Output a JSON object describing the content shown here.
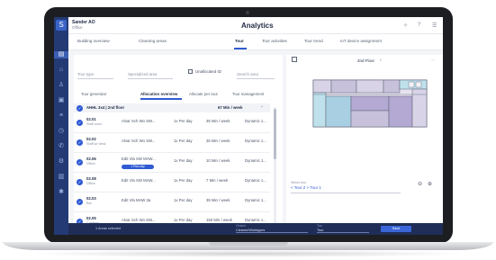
{
  "header": {
    "org_name": "Sander AO",
    "org_sub": "Office",
    "title": "Analytics"
  },
  "tabs": [
    {
      "label": "Building overview"
    },
    {
      "label": "Cleaning areas"
    },
    {
      "label": "Tour"
    },
    {
      "label": "Tour activities"
    },
    {
      "label": "Tour trend"
    },
    {
      "label": "IoT device assignment"
    }
  ],
  "filters": {
    "tour_type": "Tour type",
    "area": "Specialized area",
    "unallocated": "Unallocated ID",
    "search": "Search area"
  },
  "subtabs": [
    {
      "label": "Tour generator"
    },
    {
      "label": "Allocation overview"
    },
    {
      "label": "Allocate per tour"
    },
    {
      "label": "Tour management"
    }
  ],
  "table": {
    "header_col1": "AHHL 3x4 | 2nd floor",
    "header_col2": "67 Min / week",
    "rows": [
      {
        "code": "02.01",
        "sub": "Staff room",
        "area": "Alvar Sch Wo SW...",
        "freq": "1x Per day",
        "time": "35 Min / week",
        "status": "Dynamic 1...",
        "badge": ""
      },
      {
        "code": "02.02",
        "sub": "Staff w/ desk",
        "area": "Alvar Sch Wo SW...",
        "freq": "1x Per day",
        "time": "35 Min / week",
        "status": "Dynamic 1...",
        "badge": ""
      },
      {
        "code": "02.06",
        "sub": "Office",
        "area": "Edit Vla SW MAW...",
        "freq": "1x Per day",
        "time": "10 Min / week",
        "status": "Dynamic 1...",
        "badge": "1 Plan day"
      },
      {
        "code": "02.08",
        "sub": "Office",
        "area": "Edit Vla SW MAW...",
        "freq": "1x Per day",
        "time": "7 Min / week",
        "status": "Dynamic 1...",
        "badge": ""
      },
      {
        "code": "02.03",
        "sub": "Bar",
        "area": "Edit Vla MAW 3a",
        "freq": "1x Per day",
        "time": "35 Min / week",
        "status": "Dynamic 1...",
        "badge": ""
      },
      {
        "code": "02.05",
        "sub": "Canteen",
        "area": "Alvar Sch Wo SW...",
        "freq": "1x Per day",
        "time": "150 Min / week",
        "status": "Dynamic 1...",
        "badge": ""
      }
    ]
  },
  "map": {
    "floor": "2nd Floor",
    "tour_select_label": "Select tour",
    "tour_select_value": "< Tour 2 > Tour 1"
  },
  "bottombar": {
    "selection": "1 Areas selected",
    "field1_label": "Cleaner",
    "field1_value": "Cleaner/Worktypes",
    "field2_label": "Tour",
    "field2_value": "Tour",
    "button": "Save"
  },
  "colors": {
    "sidebar": "#233a74",
    "accent": "#2f5bd3",
    "bottombar": "#1f2d57"
  }
}
